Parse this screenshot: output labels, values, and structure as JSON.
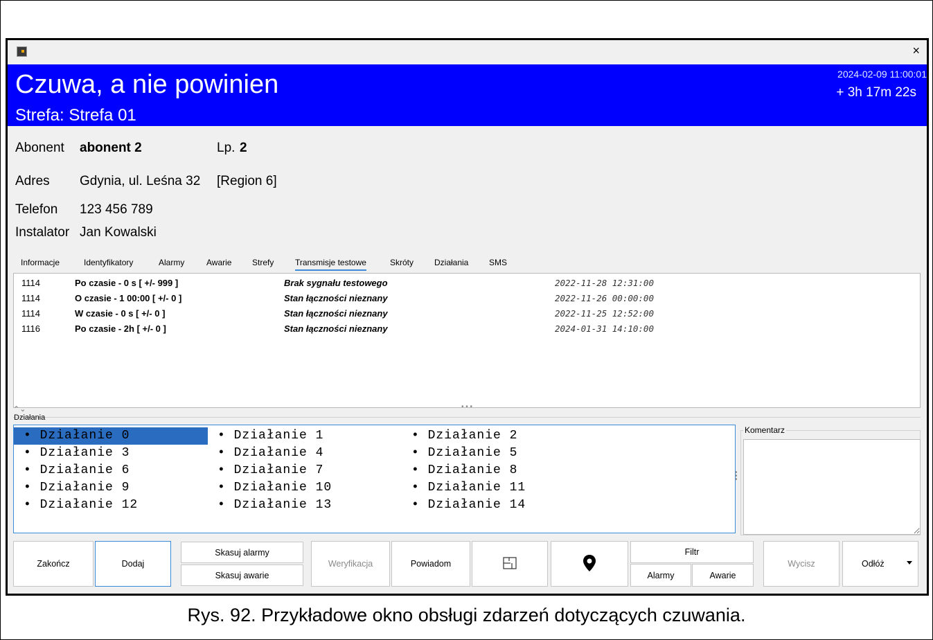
{
  "window": {
    "close_label": "×",
    "icon": "app-icon"
  },
  "banner": {
    "title": "Czuwa, a nie powinien",
    "subtitle": "Strefa: Strefa 01",
    "datetime": "2024-02-09 11:00:01",
    "elapsed": "+ 3h 17m 22s",
    "background": "#0000ff"
  },
  "info": {
    "abonent_label": "Abonent",
    "abonent_value": "abonent 2",
    "lp_label": "Lp.",
    "lp_value": "2",
    "address_label": "Adres",
    "address_value": "Gdynia, ul. Leśna 32",
    "region_value": "[Region 6]",
    "phone_label": "Telefon",
    "phone_value": "123 456 789",
    "installer_label": "Instalator",
    "installer_value": "Jan Kowalski"
  },
  "tabs": [
    {
      "label": "Informacje"
    },
    {
      "label": "Identyfikatory"
    },
    {
      "label": "Alarmy"
    },
    {
      "label": "Awarie"
    },
    {
      "label": "Strefy"
    },
    {
      "label": "Transmisje testowe",
      "active": true
    },
    {
      "label": "Skróty"
    },
    {
      "label": "Działania"
    },
    {
      "label": "SMS"
    }
  ],
  "test_transmissions": [
    {
      "id": "1114",
      "rule": "Po czasie - 0 s [ +/- 999 ]",
      "state": "Brak sygnału testowego",
      "date": "2022-11-28 12:31:00"
    },
    {
      "id": "1114",
      "rule": "O czasie - 1 00:00 [ +/- 0 ]",
      "state": "Stan łączności nieznany",
      "date": "2022-11-26 00:00:00"
    },
    {
      "id": "1114",
      "rule": "W czasie - 0 s [ +/- 0 ]",
      "state": "Stan łączności nieznany",
      "date": "2022-11-25 12:52:00"
    },
    {
      "id": "1116",
      "rule": "Po czasie - 2h  [ +/- 0 ]",
      "state": "Stan łączności nieznany",
      "date": "2024-01-31 14:10:00"
    }
  ],
  "actions": {
    "title": "Działania",
    "items": [
      "• Działanie 0",
      "• Działanie 1",
      "• Działanie 2",
      "• Działanie 3",
      "• Działanie 4",
      "• Działanie 5",
      "• Działanie 6",
      "• Działanie 7",
      "• Działanie 8",
      "• Działanie 9",
      "• Działanie 10",
      "• Działanie 11",
      "• Działanie 12",
      "• Działanie 13",
      "• Działanie 14"
    ],
    "selected_index": 0
  },
  "comment": {
    "title": "Komentarz",
    "value": ""
  },
  "buttons": {
    "finish": "Zakończ",
    "add": "Dodaj",
    "clear_alarms": "Skasuj alarmy",
    "clear_faults": "Skasuj awarie",
    "verify": "Weryfikacja",
    "notify": "Powiadom",
    "plan_icon": "floor-plan-icon",
    "map_icon": "map-pin-icon",
    "filter": "Filtr",
    "filter_alarms": "Alarmy",
    "filter_faults": "Awarie",
    "mute": "Wycisz",
    "postpone": "Odłóż"
  },
  "caption": "Rys. 92. Przykładowe okno obsługi zdarzeń dotyczących czuwania."
}
